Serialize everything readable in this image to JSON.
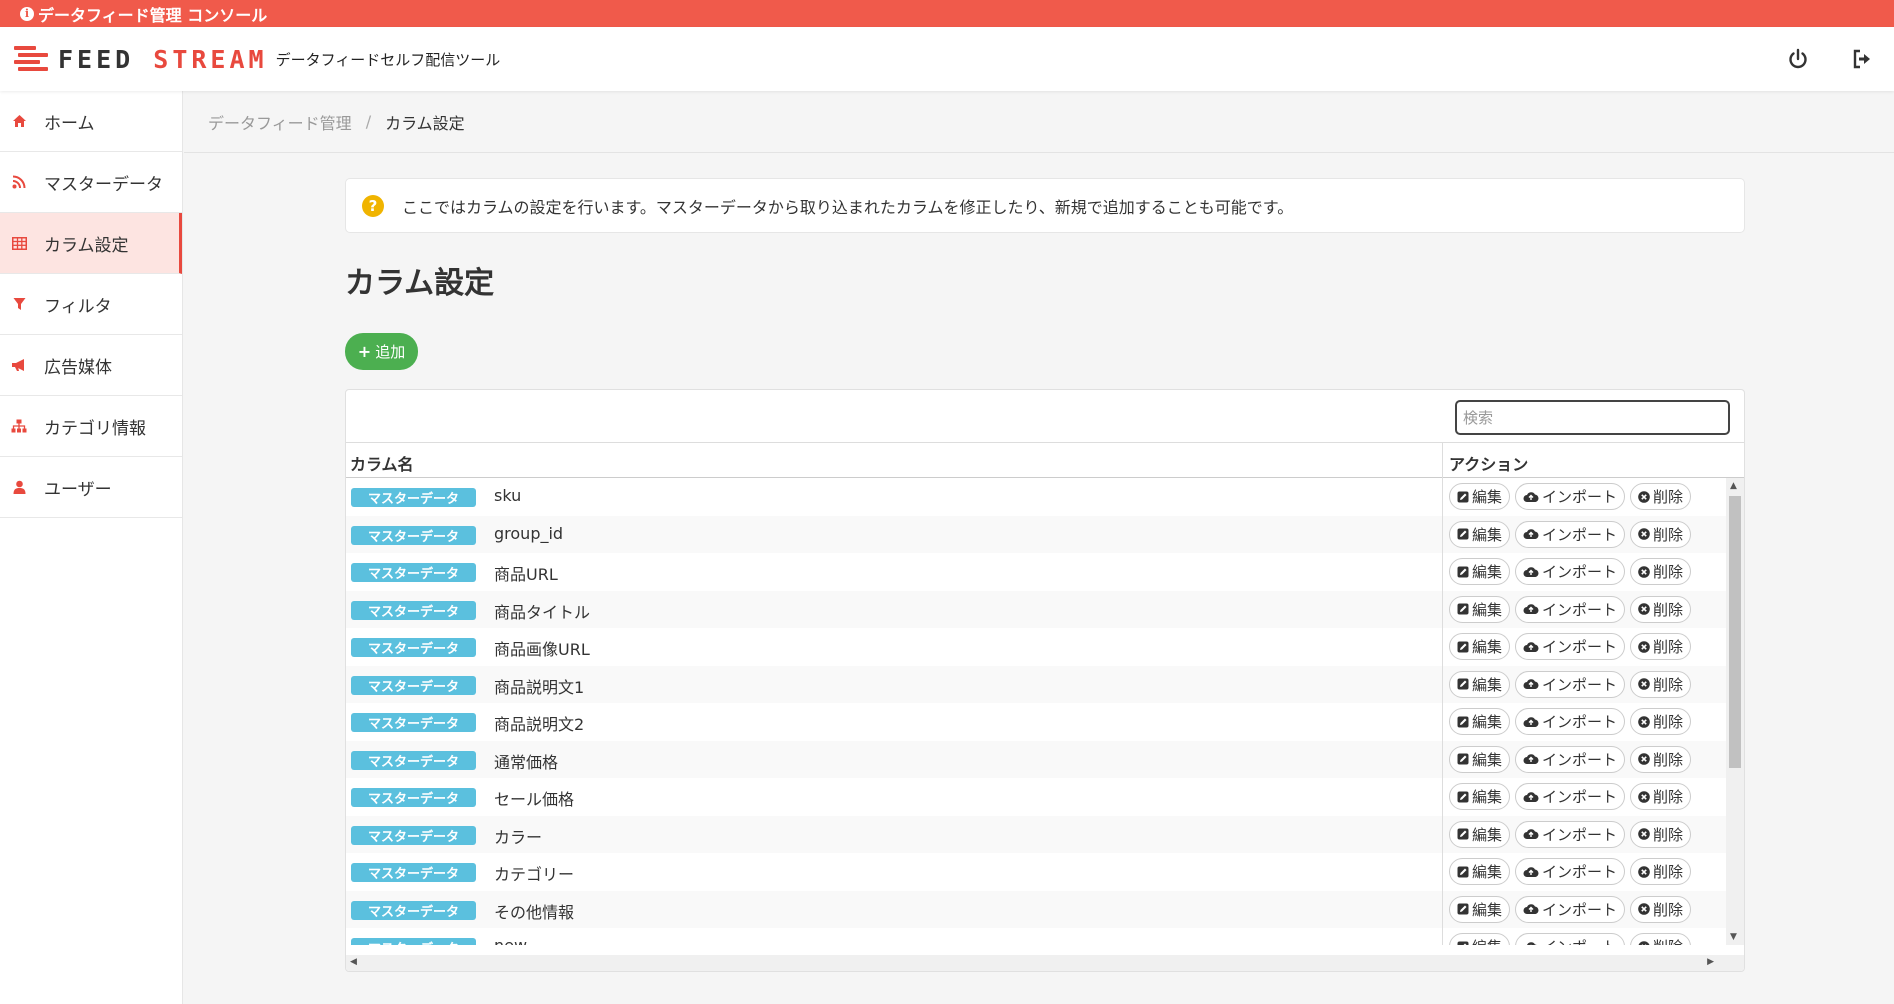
{
  "banner": {
    "text": "データフィード管理 コンソール"
  },
  "header": {
    "logo_word1": "FEED",
    "logo_word2": "STREAM",
    "tagline": "データフィードセルフ配信ツール"
  },
  "sidebar": {
    "items": [
      {
        "label": "ホーム",
        "icon": "home-icon"
      },
      {
        "label": "マスターデータ",
        "icon": "rss-icon"
      },
      {
        "label": "カラム設定",
        "icon": "table-icon"
      },
      {
        "label": "フィルタ",
        "icon": "filter-icon"
      },
      {
        "label": "広告媒体",
        "icon": "megaphone-icon"
      },
      {
        "label": "カテゴリ情報",
        "icon": "sitemap-icon"
      },
      {
        "label": "ユーザー",
        "icon": "user-icon"
      }
    ],
    "active_index": 2
  },
  "breadcrumb": {
    "parent": "データフィード管理",
    "separator": "/",
    "current": "カラム設定"
  },
  "info": {
    "text": "ここではカラムの設定を行います。マスターデータから取り込まれたカラムを修正したり、新規で追加することも可能です。"
  },
  "page_title": "カラム設定",
  "add_button": "追加",
  "search": {
    "placeholder": "検索"
  },
  "table": {
    "headers": {
      "column_name": "カラム名",
      "action": "アクション"
    },
    "actions": {
      "edit": "編集",
      "import": "インポート",
      "delete": "削除"
    },
    "rows": [
      {
        "badge": "マスターデータ",
        "name": "sku"
      },
      {
        "badge": "マスターデータ",
        "name": "group_id"
      },
      {
        "badge": "マスターデータ",
        "name": "商品URL"
      },
      {
        "badge": "マスターデータ",
        "name": "商品タイトル"
      },
      {
        "badge": "マスターデータ",
        "name": "商品画像URL"
      },
      {
        "badge": "マスターデータ",
        "name": "商品説明文1"
      },
      {
        "badge": "マスターデータ",
        "name": "商品説明文2"
      },
      {
        "badge": "マスターデータ",
        "name": "通常価格"
      },
      {
        "badge": "マスターデータ",
        "name": "セール価格"
      },
      {
        "badge": "マスターデータ",
        "name": "カラー"
      },
      {
        "badge": "マスターデータ",
        "name": "カテゴリー"
      },
      {
        "badge": "マスターデータ",
        "name": "その他情報"
      },
      {
        "badge": "マスターデータ",
        "name": "new"
      }
    ]
  },
  "colors": {
    "brand_red": "#e8493e",
    "banner_red": "#f05a4b",
    "badge_blue": "#5bc0de",
    "add_green": "#4caf50"
  }
}
